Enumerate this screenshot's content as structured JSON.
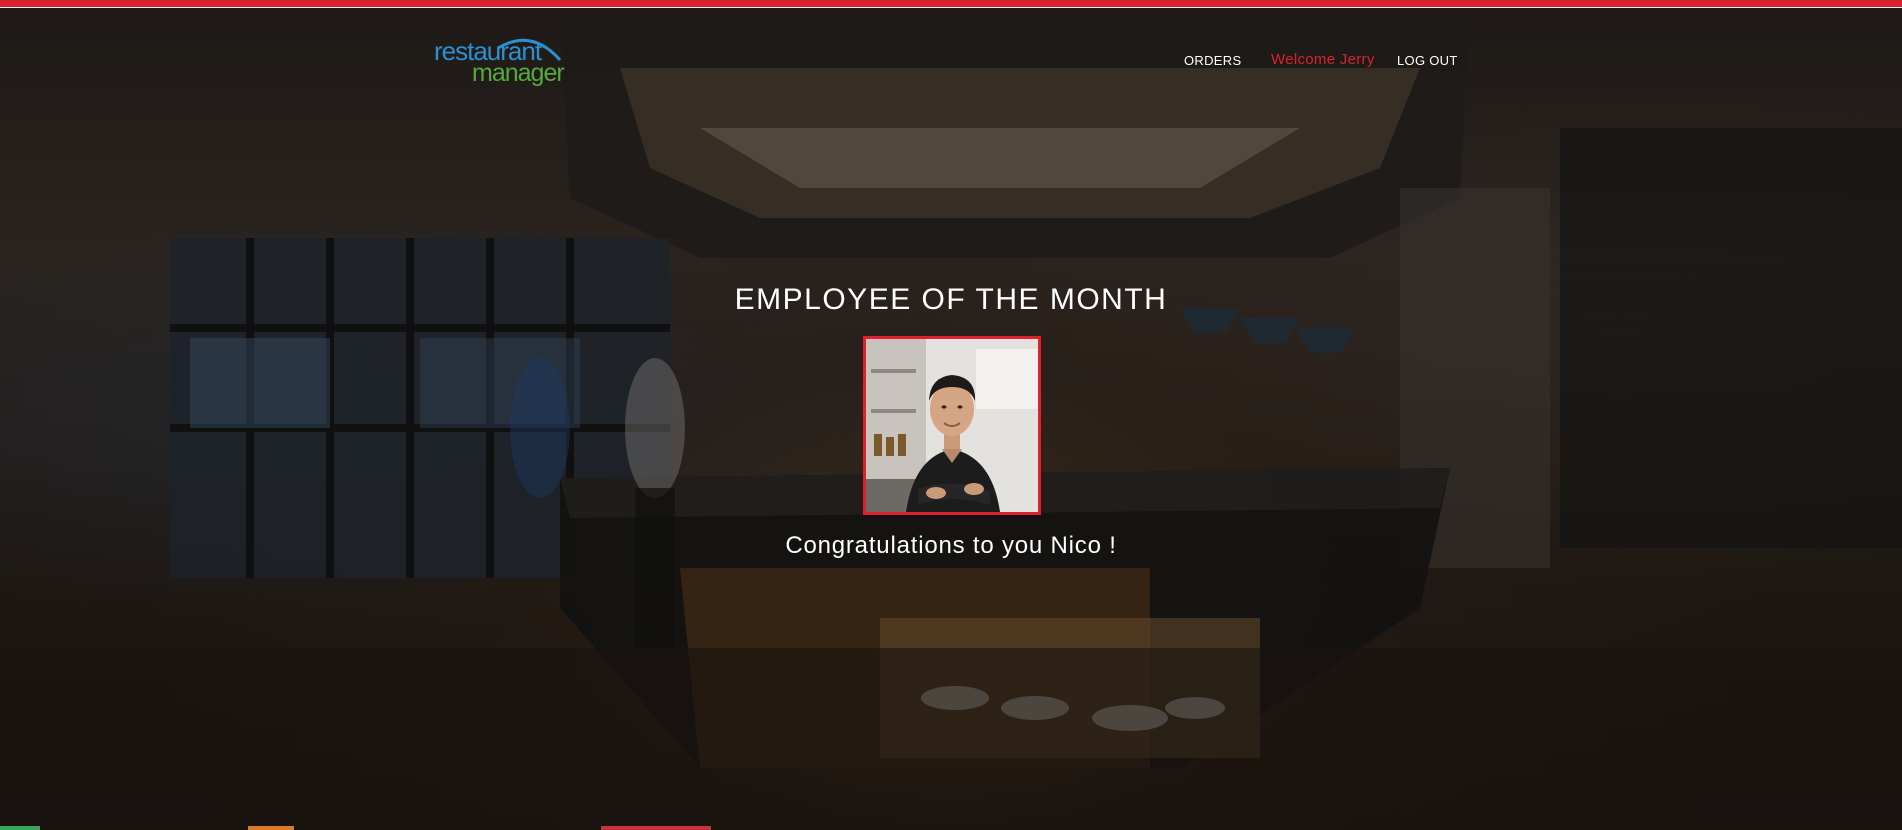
{
  "app": {
    "logo_line1": "restaurant",
    "logo_line2": "manager"
  },
  "header": {
    "nav_orders": "ORDERS",
    "welcome_text": "Welcome Jerry",
    "nav_logout": "LOG OUT"
  },
  "main": {
    "title": "EMPLOYEE OF THE MONTH",
    "congrats_text": "Congratulations to you Nico !",
    "photo_icon": "employee-photo"
  },
  "colors": {
    "accent_red": "#d9232e",
    "logo_blue": "#2b8fd0",
    "logo_green": "#56a93b",
    "text_white": "#ffffff"
  }
}
